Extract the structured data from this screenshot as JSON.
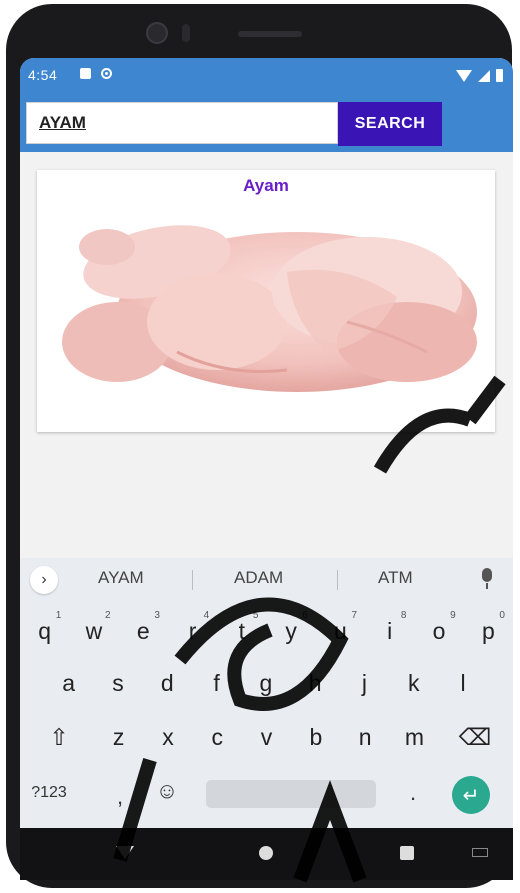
{
  "status_bar": {
    "time": "4:54"
  },
  "search": {
    "value": "AYAM",
    "button_label": "SEARCH"
  },
  "result_card": {
    "title": "Ayam"
  },
  "keyboard": {
    "suggestions": [
      "AYAM",
      "ADAM",
      "ATM"
    ],
    "row1": [
      {
        "key": "q",
        "hint": "1"
      },
      {
        "key": "w",
        "hint": "2"
      },
      {
        "key": "e",
        "hint": "3"
      },
      {
        "key": "r",
        "hint": "4"
      },
      {
        "key": "t",
        "hint": "5"
      },
      {
        "key": "y",
        "hint": "6"
      },
      {
        "key": "u",
        "hint": "7"
      },
      {
        "key": "i",
        "hint": "8"
      },
      {
        "key": "o",
        "hint": "9"
      },
      {
        "key": "p",
        "hint": "0"
      }
    ],
    "row2": [
      "a",
      "s",
      "d",
      "f",
      "g",
      "h",
      "j",
      "k",
      "l"
    ],
    "row3": [
      "z",
      "x",
      "c",
      "v",
      "b",
      "n",
      "m"
    ],
    "symbols_label": "?123",
    "comma_label": ",",
    "period_label": ".",
    "shift_glyph": "⇧",
    "backspace_glyph": "⌫",
    "emoji_glyph": "☺",
    "enter_glyph": "↵"
  },
  "colors": {
    "app_blue": "#3e86d0",
    "search_button": "#3a14b4",
    "title_purple": "#6a1ec8",
    "enter_green": "#2aa890"
  }
}
